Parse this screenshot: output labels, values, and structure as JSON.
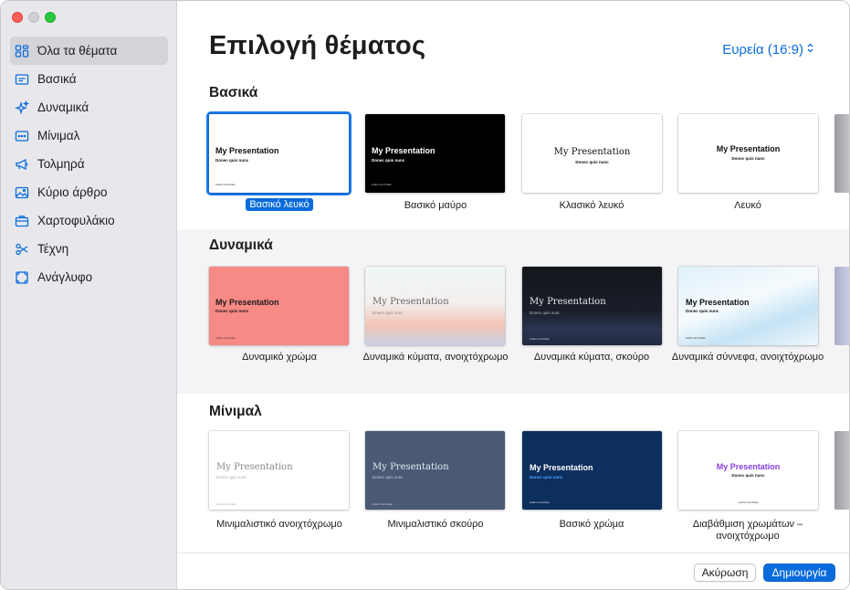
{
  "sidebar": {
    "items": [
      {
        "label": "Όλα τα θέματα",
        "icon": "grid-icon",
        "active": true
      },
      {
        "label": "Βασικά",
        "icon": "basic-slide-icon"
      },
      {
        "label": "Δυναμικά",
        "icon": "sparkles-icon"
      },
      {
        "label": "Μίνιμαλ",
        "icon": "minimal-slide-icon"
      },
      {
        "label": "Τολμηρά",
        "icon": "megaphone-icon"
      },
      {
        "label": "Κύριο άρθρο",
        "icon": "photo-icon"
      },
      {
        "label": "Χαρτοφυλάκιο",
        "icon": "briefcase-icon"
      },
      {
        "label": "Τέχνη",
        "icon": "scissors-icon"
      },
      {
        "label": "Ανάγλυφο",
        "icon": "texture-icon"
      }
    ]
  },
  "header": {
    "title": "Επιλογή θέματος",
    "aspect": "Ευρεία (16:9)"
  },
  "sections": [
    {
      "title": "Βασικά",
      "themes": [
        {
          "label": "Βασικό λευκό",
          "selected": true,
          "title": "My Presentation",
          "subtitle": "Donec quis nunc",
          "author": "Author and Date"
        },
        {
          "label": "Βασικό μαύρο",
          "title": "My Presentation",
          "subtitle": "Donec quis nunc",
          "author": "Author and Date"
        },
        {
          "label": "Κλασικό λευκό",
          "title": "My Presentation",
          "subtitle": "Donec quis nunc",
          "author": ""
        },
        {
          "label": "Λευκό",
          "title": "My Presentation",
          "subtitle": "Donec quis nunc",
          "author": ""
        }
      ]
    },
    {
      "title": "Δυναμικά",
      "themes": [
        {
          "label": "Δυναμικό χρώμα",
          "title": "My Presentation",
          "subtitle": "Donec quis nunc",
          "author": "Author and Date"
        },
        {
          "label": "Δυναμικά κύματα, ανοιχτόχρωμο",
          "title": "My Presentation",
          "subtitle": "Donec quis nunc",
          "author": ""
        },
        {
          "label": "Δυναμικά κύματα, σκούρο",
          "title": "My Presentation",
          "subtitle": "Donec quis nunc",
          "author": "Author and Date"
        },
        {
          "label": "Δυναμικά σύννεφα, ανοιχτόχρωμο",
          "title": "My Presentation",
          "subtitle": "Donec quis nunc",
          "author": "Author and Date"
        }
      ]
    },
    {
      "title": "Μίνιμαλ",
      "themes": [
        {
          "label": "Μινιμαλιστικό ανοιχτόχρωμο",
          "title": "My Presentation",
          "subtitle": "Donec quis nunc",
          "author": "Author and Date"
        },
        {
          "label": "Μινιμαλιστικό σκούρο",
          "title": "My Presentation",
          "subtitle": "Donec quis nunc",
          "author": "Author and Date"
        },
        {
          "label": "Βασικό χρώμα",
          "title": "My Presentation",
          "subtitle": "Donec quis nunc",
          "author": "Author and Date"
        },
        {
          "label": "Διαβάθμιση χρωμάτων – ανοιχτόχρωμο",
          "title": "My Presentation",
          "subtitle": "Donec quis nunc",
          "author": "Author and Date"
        }
      ]
    }
  ],
  "footer": {
    "cancel_label": "Ακύρωση",
    "create_label": "Δημιουργία"
  },
  "colors": {
    "accent": "#0a6cdc",
    "sidebar_bg": "#e8e8ec"
  }
}
